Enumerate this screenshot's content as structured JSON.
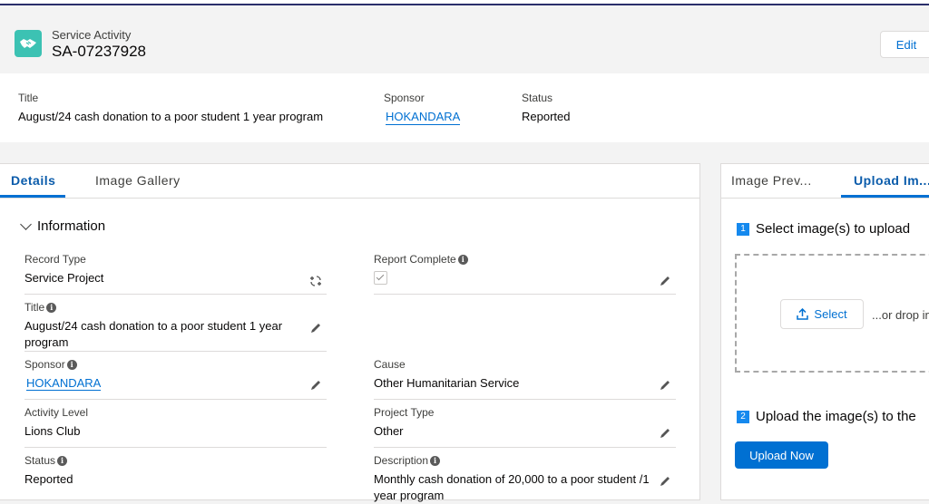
{
  "record": {
    "type_label": "Service Activity",
    "name": "SA-07237928",
    "icon": "handshake-icon",
    "edit_label": "Edit"
  },
  "highlights": [
    {
      "label": "Title",
      "value": "August/24 cash donation to a poor student 1 year program"
    },
    {
      "label": "Sponsor",
      "value": "HOKANDARA"
    },
    {
      "label": "Status",
      "value": "Reported"
    }
  ],
  "left_tabs": [
    {
      "label": "Details",
      "active": true
    },
    {
      "label": "Image Gallery",
      "active": false
    }
  ],
  "section": {
    "title": "Information"
  },
  "fields": {
    "record_type": {
      "label": "Record Type",
      "value": "Service Project"
    },
    "report_complete": {
      "label": "Report Complete",
      "checked": true
    },
    "title": {
      "label": "Title",
      "value": "August/24 cash donation to a poor student 1 year program"
    },
    "sponsor": {
      "label": "Sponsor",
      "value": "HOKANDARA"
    },
    "cause": {
      "label": "Cause",
      "value": "Other Humanitarian Service"
    },
    "activity_level": {
      "label": "Activity Level",
      "value": "Lions Club"
    },
    "project_type": {
      "label": "Project Type",
      "value": "Other"
    },
    "status": {
      "label": "Status",
      "value": "Reported"
    },
    "description": {
      "label": "Description",
      "value": "Monthly cash donation of 20,000 to a poor student /1 year program"
    }
  },
  "right_tabs": [
    {
      "label": "Image Prev...",
      "active": false
    },
    {
      "label": "Upload Im...",
      "active": true
    }
  ],
  "upload": {
    "step1_num": "1",
    "step1_label": "Select image(s) to upload",
    "select_label": "Select",
    "drop_text": "...or drop in",
    "step2_num": "2",
    "step2_label": "Upload the image(s) to the",
    "upload_now_label": "Upload Now"
  },
  "colors": {
    "brand": "#0070d2",
    "icon_bg": "#3cc2b3",
    "nav_line": "#2a2f6b"
  }
}
